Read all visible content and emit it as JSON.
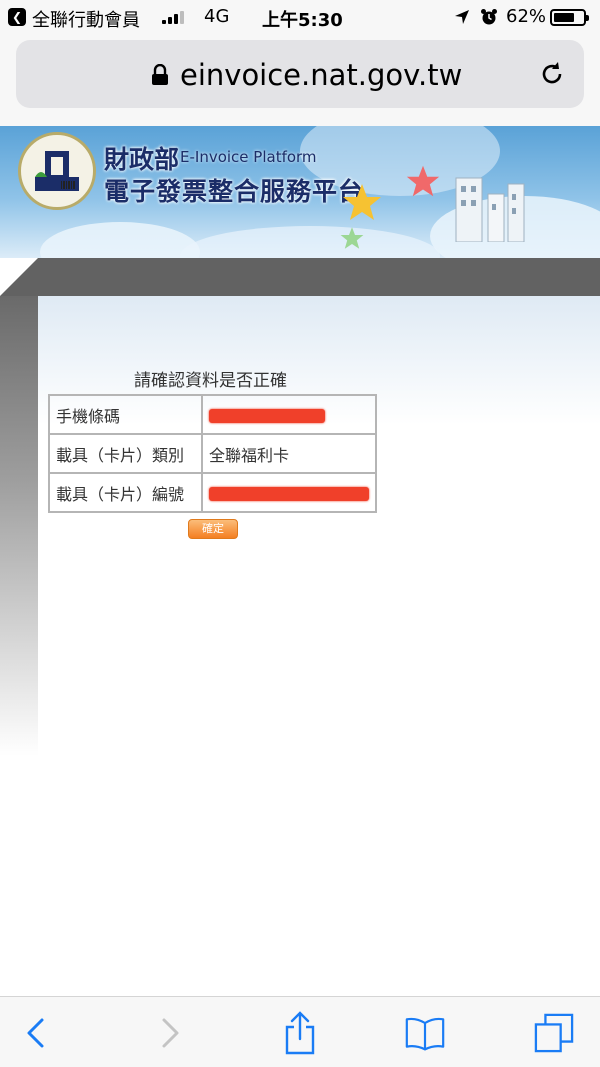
{
  "status_bar": {
    "back_icon": "back-arrow-icon",
    "carrier": "全聯行動會員",
    "network": "4G",
    "time": "上午5:30",
    "battery_percent": "62%",
    "battery_level": 0.62
  },
  "browser": {
    "url": "einvoice.nat.gov.tw",
    "lock_icon": "lock-icon",
    "reload_icon": "reload-icon"
  },
  "site_header": {
    "ministry": "財政部",
    "platform_en": "E-Invoice Platform",
    "platform_zh": "電子發票整合服務平台"
  },
  "confirm": {
    "title": "請確認資料是否正確",
    "rows": [
      {
        "label": "手機條碼",
        "value": "",
        "redacted": true
      },
      {
        "label": "載具（卡片）類別",
        "value": "全聯福利卡",
        "redacted": false
      },
      {
        "label": "載具（卡片）編號",
        "value": "",
        "redacted": true
      }
    ],
    "confirm_button": "確定"
  },
  "toolbar": {
    "icons": [
      "back-icon",
      "forward-icon",
      "share-icon",
      "bookmarks-icon",
      "tabs-icon"
    ]
  },
  "colors": {
    "accent_orange": "#f47f22",
    "header_navy": "#1b2d68",
    "ios_blue": "#1a7cf5"
  }
}
